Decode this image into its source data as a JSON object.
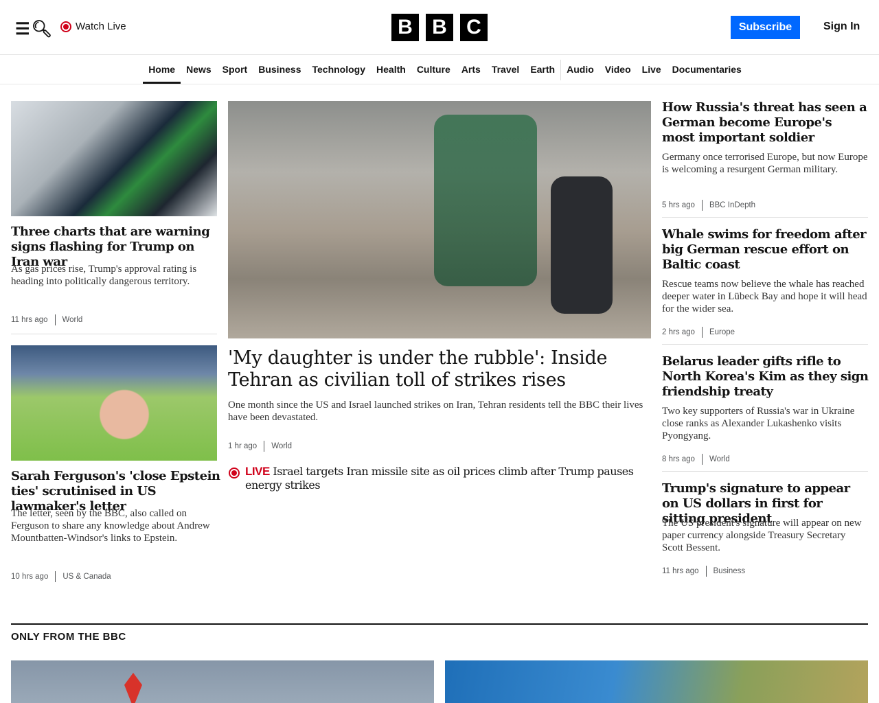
{
  "header": {
    "watch_live": "Watch Live",
    "logo": [
      "B",
      "B",
      "C"
    ],
    "subscribe": "Subscribe",
    "sign_in": "Sign In"
  },
  "nav": [
    "Home",
    "News",
    "Sport",
    "Business",
    "Technology",
    "Health",
    "Culture",
    "Arts",
    "Travel",
    "Earth",
    "Audio",
    "Video",
    "Live",
    "Documentaries"
  ],
  "left": [
    {
      "title": "Three charts that are warning signs flashing for Trump on Iran war",
      "desc": "As gas prices rise, Trump's approval rating is heading into politically dangerous territory.",
      "time": "11 hrs ago",
      "section": "World"
    },
    {
      "title": "Sarah Ferguson's 'close Epstein ties' scrutinised in US lawmaker's letter",
      "desc": "The letter, seen by the BBC, also called on Ferguson to share any knowledge about Andrew Mountbatten-Windsor's links to Epstein.",
      "time": "10 hrs ago",
      "section": "US & Canada"
    }
  ],
  "main": {
    "title": "'My daughter is under the rubble': Inside Tehran as civilian toll of strikes rises",
    "desc": "One month since the US and Israel launched strikes on Iran, Tehran residents tell the BBC their lives have been devastated.",
    "time": "1 hr ago",
    "section": "World",
    "live_label": "LIVE",
    "live_title": "Israel targets Iran missile site as oil prices climb after Trump pauses energy strikes"
  },
  "right": [
    {
      "title": "How Russia's threat has seen a German become Europe's most important soldier",
      "desc": "Germany once terrorised Europe, but now Europe is welcoming a resurgent German military.",
      "time": "5 hrs ago",
      "section": "BBC InDepth"
    },
    {
      "title": "Whale swims for freedom after big German rescue effort on Baltic coast",
      "desc": "Rescue teams now believe the whale has reached deeper water in Lübeck Bay and hope it will head for the wider sea.",
      "time": "2 hrs ago",
      "section": "Europe"
    },
    {
      "title": "Belarus leader gifts rifle to North Korea's Kim as they sign friendship treaty",
      "desc": "Two key supporters of Russia's war in Ukraine close ranks as Alexander Lukashenko visits Pyongyang.",
      "time": "8 hrs ago",
      "section": "World"
    },
    {
      "title": "Trump's signature to appear on US dollars in first for sitting president",
      "desc": "The US president's signature will appear on new paper currency alongside Treasury Secretary Scott Bessent.",
      "time": "11 hrs ago",
      "section": "Business"
    }
  ],
  "only_from": "ONLY FROM THE BBC",
  "colors": {
    "accent": "#0068ff",
    "live": "#d0021b"
  }
}
